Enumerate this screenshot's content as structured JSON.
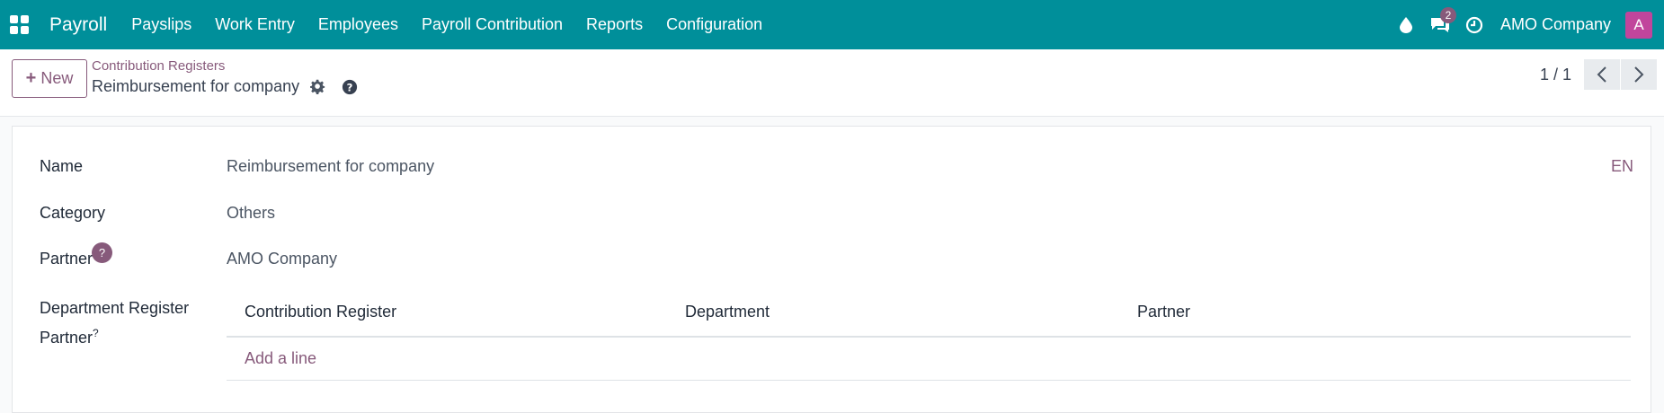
{
  "navbar": {
    "app_name": "Payroll",
    "menu": [
      "Payslips",
      "Work Entry",
      "Employees",
      "Payroll Contribution",
      "Reports",
      "Configuration"
    ],
    "messages_count": "2",
    "company": "AMO Company",
    "avatar_letter": "A",
    "color": "#008f9a"
  },
  "control": {
    "new_label": "New",
    "breadcrumb_parent": "Contribution Registers",
    "breadcrumb_current": "Reimbursement for company",
    "pager": "1 / 1"
  },
  "form": {
    "name_label": "Name",
    "name_value": "Reimbursement for company",
    "lang": "EN",
    "category_label": "Category",
    "category_value": "Others",
    "partner_label": "Partner",
    "partner_help": "?",
    "partner_value": "AMO Company",
    "dept_label_line1": "Department Register",
    "dept_label_line2": "Partner",
    "dept_label_sup": "?",
    "table": {
      "columns": [
        "Contribution Register",
        "Department",
        "Partner"
      ],
      "add_line": "Add a line"
    }
  },
  "accent_color": "#875a7b"
}
